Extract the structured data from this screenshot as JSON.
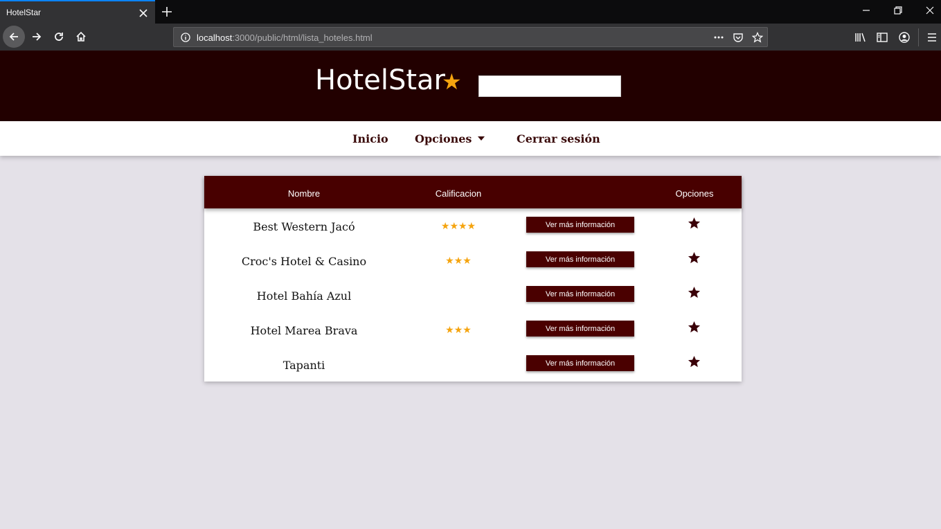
{
  "browser": {
    "tab_title": "HotelStar",
    "url_host": "localhost",
    "url_path": ":3000/public/html/lista_hoteles.html"
  },
  "site": {
    "logo_text": "HotelStar",
    "logo_star": "★"
  },
  "menu": {
    "items": [
      {
        "label": "Inicio"
      },
      {
        "label": "Opciones"
      },
      {
        "label": "Cerrar sesión"
      }
    ]
  },
  "table": {
    "columns": [
      "Nombre",
      "Calificacion",
      "",
      "Opciones"
    ],
    "button_label": "Ver más información",
    "rows": [
      {
        "name": "Best Western Jacó",
        "rating": "★★★★",
        "stars": 4
      },
      {
        "name": "Croc's Hotel & Casino",
        "rating": "★★★",
        "stars": 3
      },
      {
        "name": "Hotel Bahía Azul",
        "rating": "",
        "stars": 0
      },
      {
        "name": "Hotel Marea Brava",
        "rating": "★★★",
        "stars": 3
      },
      {
        "name": "Tapanti",
        "rating": "",
        "stars": 0
      }
    ]
  },
  "colors": {
    "header_bg": "#220000",
    "table_header_bg": "#480000",
    "button_bg": "#4a0000",
    "star_gold": "#f5a40f",
    "fav_star": "#3a0008"
  }
}
